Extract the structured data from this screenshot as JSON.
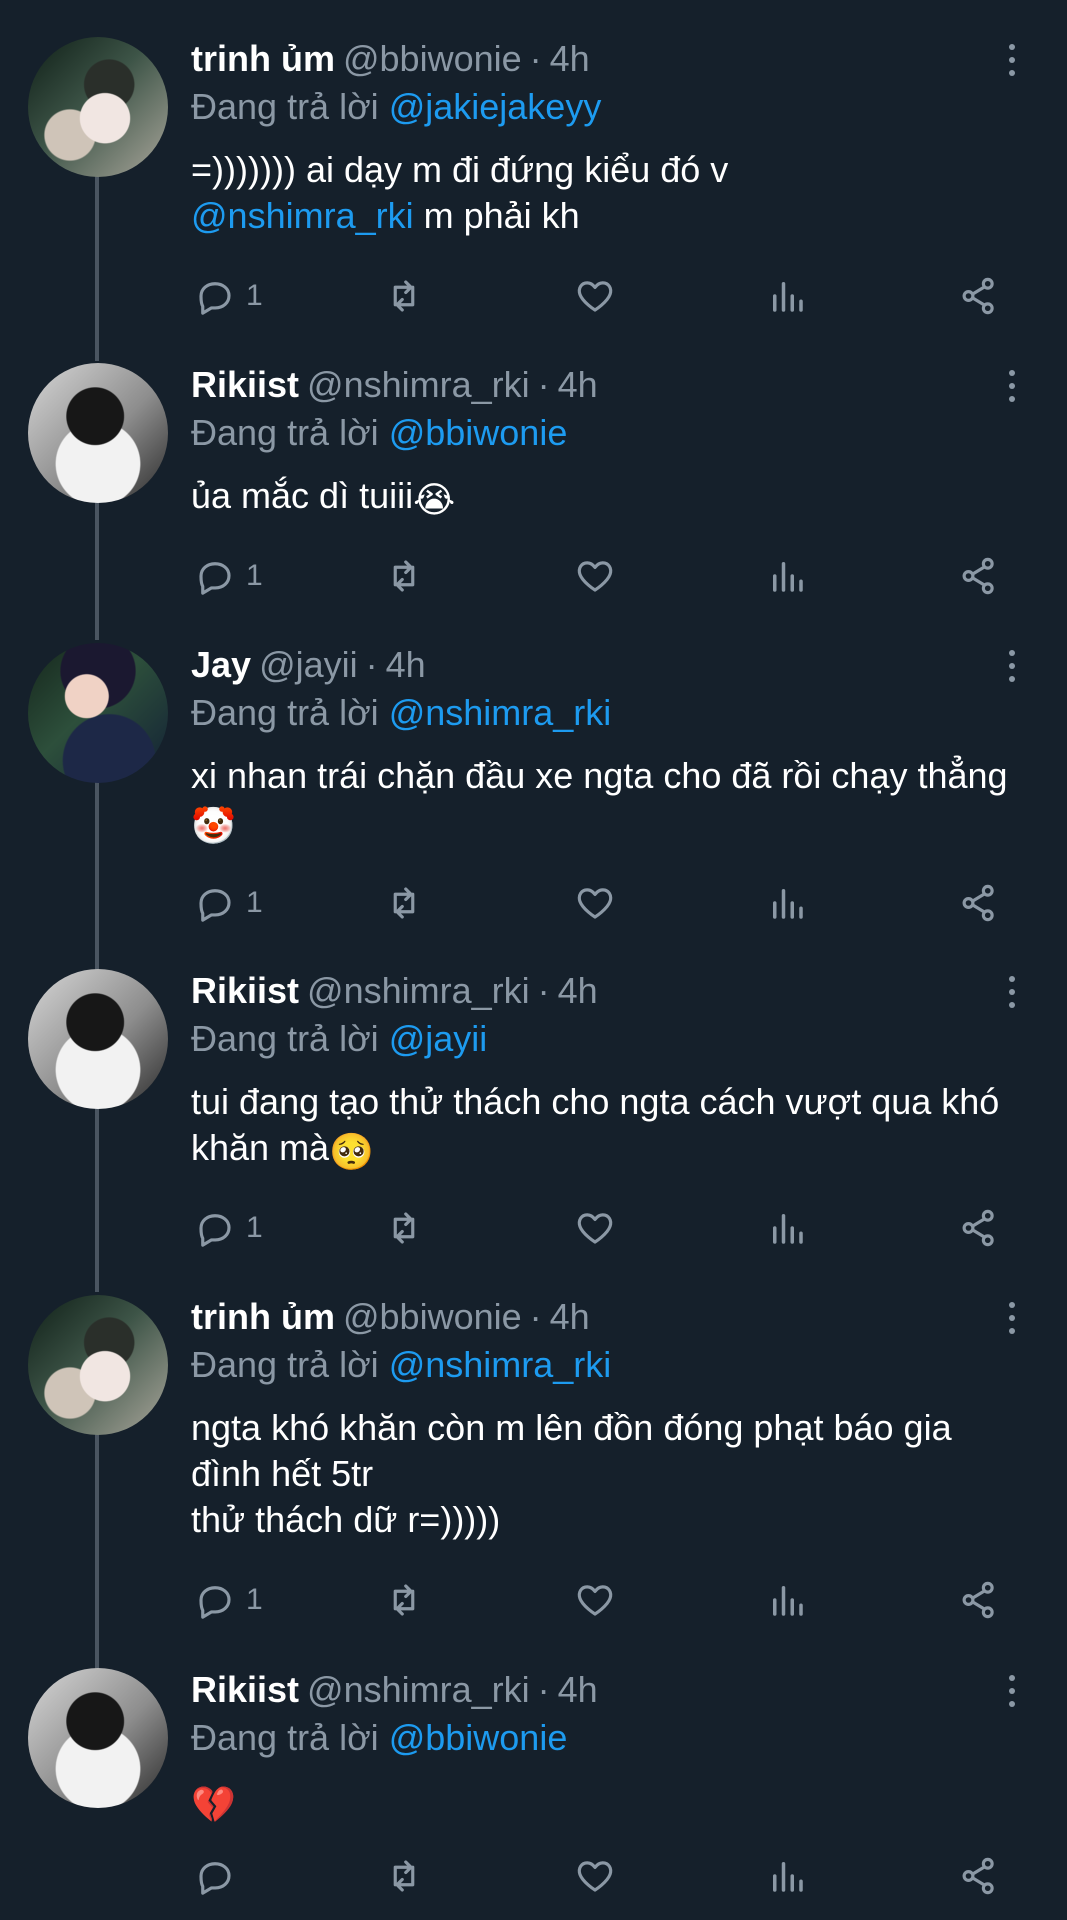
{
  "theme": {
    "background": "#15202b",
    "text": "#ffffff",
    "muted": "#8b98a5",
    "accent": "#1d9bf0",
    "thread_line": "#4a5561"
  },
  "icons": {
    "reply": "reply-icon",
    "retweet": "retweet-icon",
    "like": "heart-icon",
    "views": "analytics-icon",
    "share": "share-icon",
    "more": "more-vertical-icon"
  },
  "tweets": [
    {
      "name": "trinh ủm",
      "handle": "@bbiwonie",
      "dot": "·",
      "time": "4h",
      "reply_prefix": "Đang trả lời",
      "reply_to": "@jakiejakeyy",
      "text_1": "=))))))) ai dạy m đi đứng kiểu đó v",
      "mention_in_text": "@nshimra_rki",
      "text_2": " m phải kh",
      "reply_count": "1"
    },
    {
      "name": "Rikiist",
      "handle": "@nshimra_rki",
      "dot": "·",
      "time": "4h",
      "reply_prefix": "Đang trả lời",
      "reply_to": "@bbiwonie",
      "text": "ủa mắc dì tuiii",
      "emoji": "😭",
      "reply_count": "1"
    },
    {
      "name": "Jay",
      "handle": "@jayii",
      "dot": "·",
      "time": "4h",
      "reply_prefix": "Đang trả lời",
      "reply_to": "@nshimra_rki",
      "text": "xi nhan trái chặn đầu xe ngta cho đã rồi chạy thẳng",
      "emoji": "🤡",
      "reply_count": "1"
    },
    {
      "name": "Rikiist",
      "handle": "@nshimra_rki",
      "dot": "·",
      "time": "4h",
      "reply_prefix": "Đang trả lời",
      "reply_to": "@jayii",
      "text": "tui đang tạo thử thách cho ngta cách vượt qua khó khăn mà",
      "emoji": "🥺",
      "reply_count": "1"
    },
    {
      "name": "trinh ủm",
      "handle": "@bbiwonie",
      "dot": "·",
      "time": "4h",
      "reply_prefix": "Đang trả lời",
      "reply_to": "@nshimra_rki",
      "text": "ngta khó khăn còn m lên đồn đóng phạt báo gia đình hết 5tr\nthử thách dữ r=)))))",
      "reply_count": "1"
    },
    {
      "name": "Rikiist",
      "handle": "@nshimra_rki",
      "dot": "·",
      "time": "4h",
      "reply_prefix": "Đang trả lời",
      "reply_to": "@bbiwonie",
      "emoji": "💔",
      "reply_count": ""
    }
  ]
}
